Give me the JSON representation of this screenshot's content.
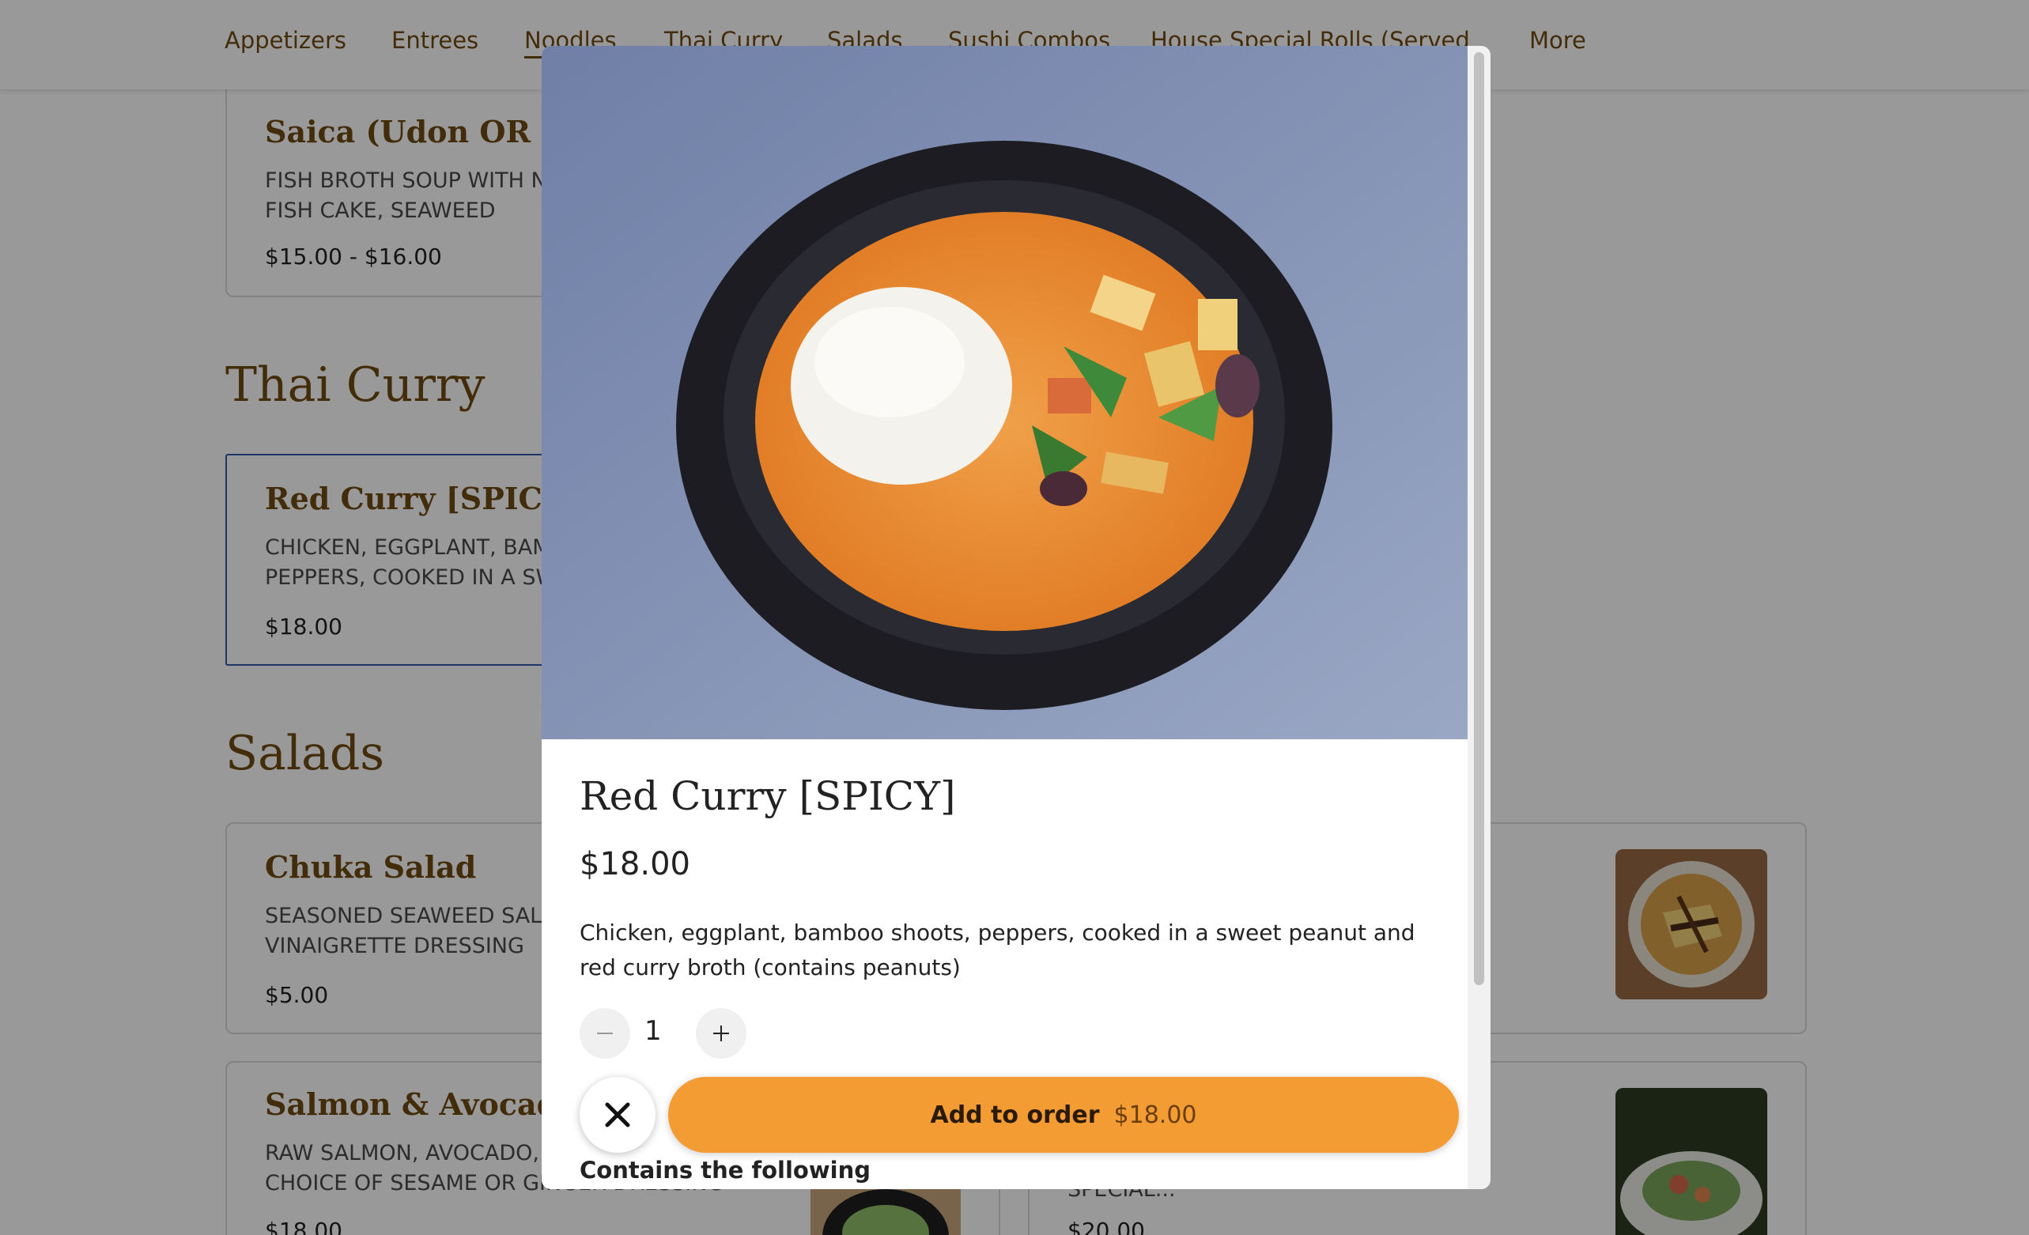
{
  "nav": {
    "items": [
      {
        "label": "Appetizers"
      },
      {
        "label": "Entrees"
      },
      {
        "label": "Noodles"
      },
      {
        "label": "Thai Curry"
      },
      {
        "label": "Salads"
      },
      {
        "label": "Sushi Combos"
      },
      {
        "label": "House Special Rolls (Served"
      },
      {
        "label": "More"
      }
    ],
    "active": "Noodles"
  },
  "menu": {
    "noodles_item": {
      "name": "Saica (Udon OR Soba)",
      "desc": "FISH BROTH SOUP WITH NOODLES, TEMPURA, FISH CAKE, SEAWEED",
      "price": "$15.00 - $16.00"
    },
    "thai_curry": {
      "title": "Thai Curry",
      "item": {
        "name": "Red Curry [SPICY]",
        "desc": "CHICKEN, EGGPLANT, BAMBOO SHOOTS, PEPPERS, COOKED IN A SWEET PEANUT",
        "price": "$18.00"
      }
    },
    "salads": {
      "title": "Salads",
      "items": [
        {
          "name": "Chuka Salad",
          "desc": "SEASONED SEAWEED SALAD WITH VINAIGRETTE DRESSING",
          "price": "$5.00"
        },
        {
          "name": "Salmon & Avocado",
          "desc": "RAW SALMON, AVOCADO, SPRING MIX WITH A CHOICE OF SESAME OR GINGER DRESSING",
          "price": "$18.00"
        },
        {
          "name": "",
          "desc": "OF SPRING MIX SERVED WITH HOUSE SPECIAL...",
          "price": "$20.00"
        }
      ]
    }
  },
  "modal": {
    "title": "Red Curry [SPICY]",
    "price": "$18.00",
    "description": "Chicken, eggplant, bamboo shoots, peppers, cooked in a sweet peanut and red curry broth (contains peanuts)",
    "quantity": "1",
    "add_label": "Add to order",
    "add_price": "$18.00",
    "contains_label": "Contains the following"
  },
  "colors": {
    "accent": "#f39c34",
    "brand_brown": "#6e4a12",
    "selected_border": "#2f5aa8"
  }
}
